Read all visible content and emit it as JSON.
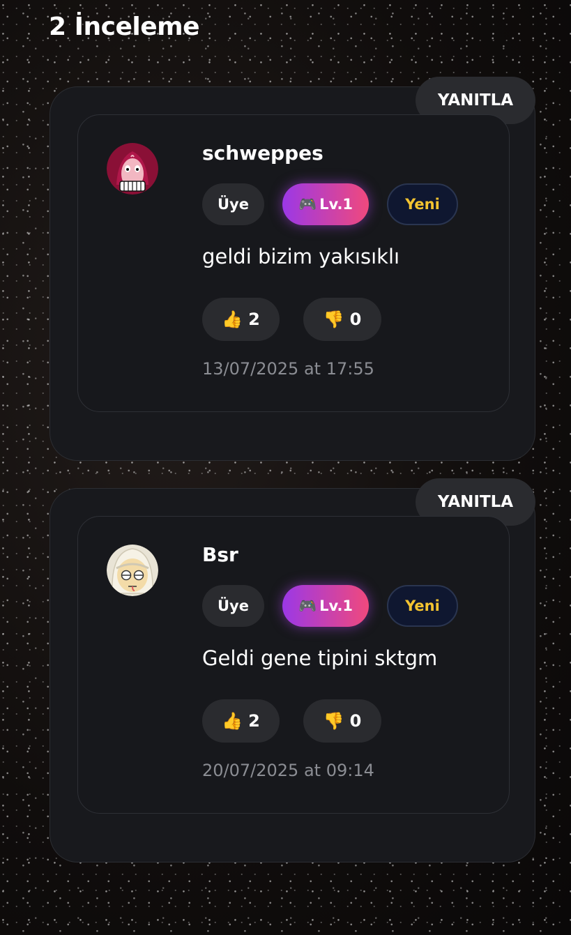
{
  "heading": "2 İnceleme",
  "reviews": [
    {
      "reply_label": "YANITLA",
      "username": "schweppes",
      "badges": {
        "member": "Üye",
        "level_icon": "🎮",
        "level": "Lv.1",
        "new": "Yeni"
      },
      "comment": "geldi bizim yakısıklı",
      "likes": {
        "icon": "👍",
        "count": "2"
      },
      "dislikes": {
        "icon": "👎",
        "count": "0"
      },
      "date": "13/07/2025 at 17:55",
      "avatar": "red-monster-avatar"
    },
    {
      "reply_label": "YANITLA",
      "username": "Bsr",
      "badges": {
        "member": "Üye",
        "level_icon": "🎮",
        "level": "Lv.1",
        "new": "Yeni"
      },
      "comment": "Geldi gene tipini sktgm",
      "likes": {
        "icon": "👍",
        "count": "2"
      },
      "dislikes": {
        "icon": "👎",
        "count": "0"
      },
      "date": "20/07/2025 at 09:14",
      "avatar": "hooded-face-avatar"
    }
  ],
  "colors": {
    "card_bg": "#18191d",
    "pill_bg": "#2a2b2f",
    "level_gradient_start": "#9b38e6",
    "level_gradient_end": "#f0497d",
    "new_text": "#f4c430",
    "date_text": "#8b8d93"
  }
}
